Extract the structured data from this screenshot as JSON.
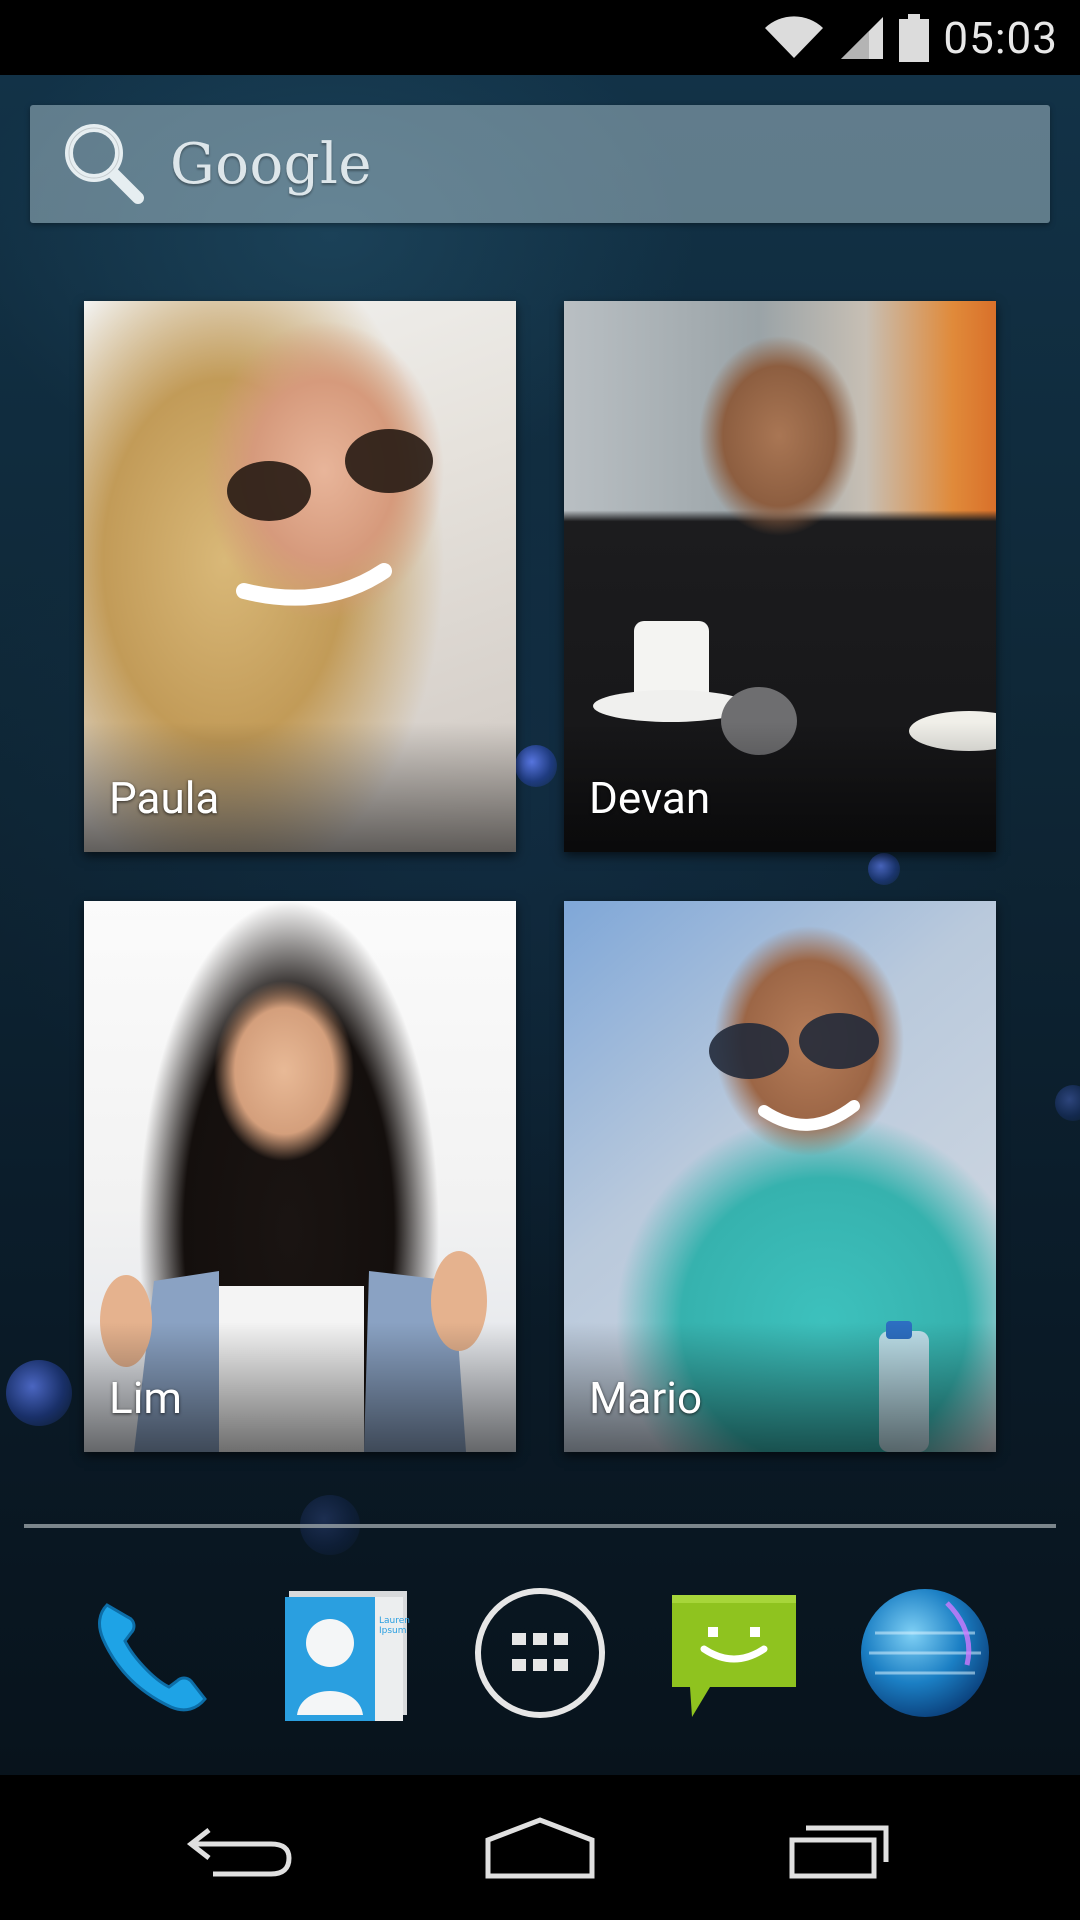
{
  "status_bar": {
    "time": "05:03",
    "icons": [
      "wifi-icon",
      "signal-icon",
      "battery-icon"
    ]
  },
  "search": {
    "icon": "search-icon",
    "label": "Google"
  },
  "contacts": [
    {
      "name": "Paula",
      "avatar": "blonde-woman-sunglasses-photo"
    },
    {
      "name": "Devan",
      "avatar": "man-cafe-coffee-photo"
    },
    {
      "name": "Lim",
      "avatar": "woman-thumbs-up-photo"
    },
    {
      "name": "Mario",
      "avatar": "man-sunglasses-teal-shirt-photo"
    }
  ],
  "dock": {
    "apps": [
      {
        "name": "phone-app",
        "icon": "phone-icon"
      },
      {
        "name": "contacts-app",
        "icon": "contacts-card-icon",
        "card_text": "Lauren Ipsum"
      },
      {
        "name": "app-drawer",
        "icon": "apps-grid-icon"
      },
      {
        "name": "messaging-app",
        "icon": "message-bubble-icon"
      },
      {
        "name": "browser-app",
        "icon": "globe-icon"
      }
    ]
  },
  "nav_bar": {
    "buttons": [
      "back-icon",
      "home-icon",
      "recents-icon"
    ]
  }
}
